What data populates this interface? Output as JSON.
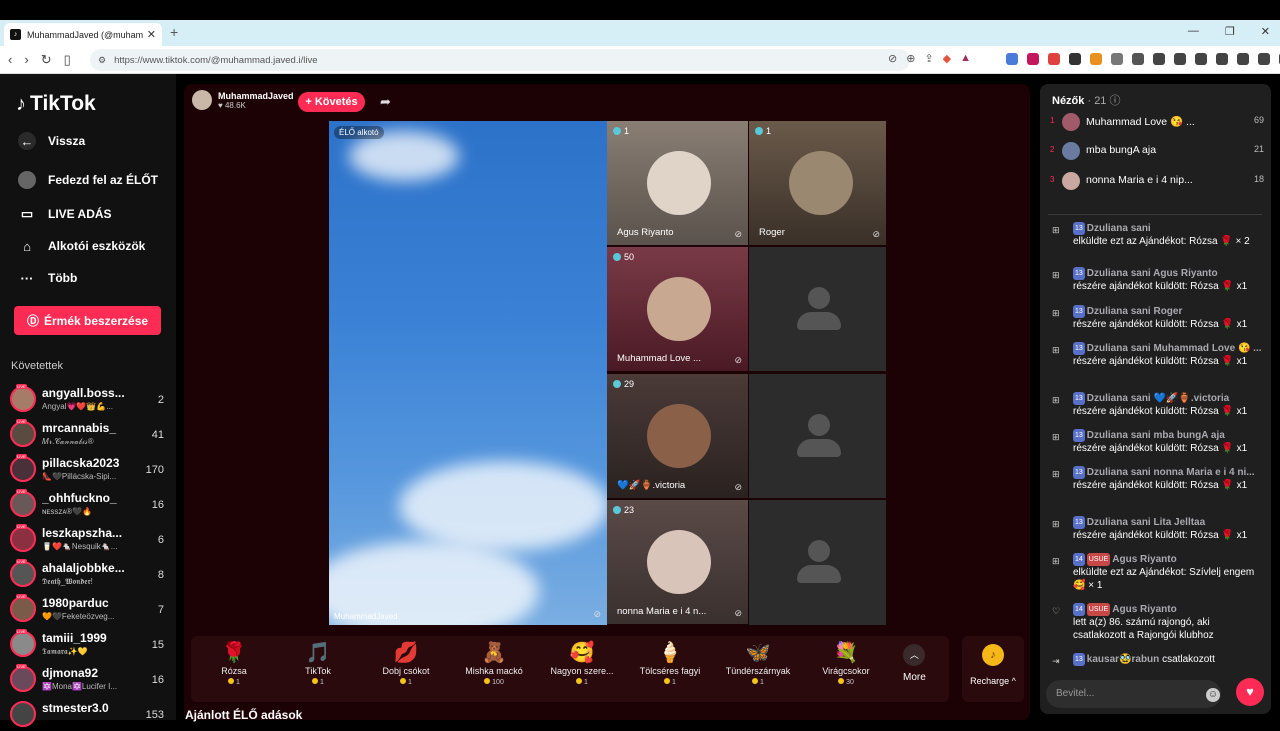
{
  "browser": {
    "tab_title": "MuhammadJaved (@muhamma",
    "url": "https://www.tiktok.com/@muhammad.javed.i/live"
  },
  "sidebar": {
    "logo": "TikTok",
    "nav": [
      {
        "label": "Vissza",
        "icon": "back-arrow-icon"
      },
      {
        "label": "Fedezd fel az ÉLŐT",
        "icon": "explore-live-icon"
      },
      {
        "label": "LIVE ADÁS",
        "icon": "video-icon"
      },
      {
        "label": "Alkotói eszközök",
        "icon": "lightbulb-icon"
      },
      {
        "label": "Több",
        "icon": "more-dots-icon"
      }
    ],
    "coins_button": "Érmék beszerzése",
    "following_heading": "Követettek",
    "following": [
      {
        "name": "angyall.boss...",
        "sub": "Angyal💗❤️👑💪...",
        "count": "2"
      },
      {
        "name": "mrcannabis_",
        "sub": "𝑀𝓇.𝒞𝒶𝓃𝓃𝒶𝒷𝒾𝓈®",
        "count": "41"
      },
      {
        "name": "pillacska2023",
        "sub": "👠🖤Pillácska-Sipi...",
        "count": "170"
      },
      {
        "name": "_ohhfuckno_",
        "sub": "ɴᴇssᴢᴀ®🖤🔥",
        "count": "16"
      },
      {
        "name": "leszkapszha...",
        "sub": "🥛❤️🐁Nesquik🐁...",
        "count": "6"
      },
      {
        "name": "ahalaljobbke...",
        "sub": "𝕯𝖊𝖆𝖙𝖍_𝖂𝖔𝖓𝖉𝖊𝖗!",
        "count": "8"
      },
      {
        "name": "1980parduc",
        "sub": "🧡🖤Feketeözveg...",
        "count": "7"
      },
      {
        "name": "tamiii_1999",
        "sub": "𝕿𝖆𝖒𝖆𝖗𝖆✨💛",
        "count": "15"
      },
      {
        "name": "djmona92",
        "sub": "🔯Mona🔯Lucifer I...",
        "count": "16"
      },
      {
        "name": "stmester3.0",
        "sub": "",
        "count": "153"
      }
    ]
  },
  "stream": {
    "host_name": "MuhammadJaved",
    "host_likes": "♥ 48.6K",
    "follow_button": "+ Követés",
    "main_badge": "ÉLŐ alkotó",
    "main_label": "MuhammadJaved",
    "cells": [
      {
        "count": "1",
        "name": "Agus Riyanto"
      },
      {
        "count": "1",
        "name": "Roger"
      },
      {
        "count": "50",
        "name": "Muhammad Love ..."
      },
      {
        "count": "29",
        "name": "💙🚀🏺.victoria"
      },
      {
        "count": "23",
        "name": "nonna Maria e i 4 n..."
      }
    ],
    "gifts": [
      {
        "name": "Rózsa",
        "price": "1",
        "icon": "🌹"
      },
      {
        "name": "TikTok",
        "price": "1",
        "icon": "🎵"
      },
      {
        "name": "Dobj csókot",
        "price": "1",
        "icon": "💋"
      },
      {
        "name": "Mishka mackó",
        "price": "100",
        "icon": "🧸"
      },
      {
        "name": "Nagyon szere...",
        "price": "1",
        "icon": "🥰"
      },
      {
        "name": "Tölcséres fagyi",
        "price": "1",
        "icon": "🍦"
      },
      {
        "name": "Tündérszárnyak",
        "price": "1",
        "icon": "🦋"
      },
      {
        "name": "Virágcsokor",
        "price": "30",
        "icon": "💐"
      }
    ],
    "more_label": "More",
    "recharge_label": "Recharge ^"
  },
  "recommended_heading": "Ajánlott ÉLŐ adások",
  "chat": {
    "viewers_label": "Nézők",
    "viewers_count": "· 21",
    "top_viewers": [
      {
        "rank": "1",
        "name": "Muhammad Love 😘 ...",
        "count": "69"
      },
      {
        "rank": "2",
        "name": "mba bungA aja",
        "count": "21"
      },
      {
        "rank": "3",
        "name": "nonna Maria e i 4 nip...",
        "count": "18"
      }
    ],
    "messages": [
      {
        "level": "13",
        "user": "Dzuliana sani",
        "text": "elküldte ezt az Ajándékot: Rózsa 🌹 × 2",
        "icon": "gift-icon"
      },
      {
        "level": "13",
        "user": "Dzuliana sani Agus Riyanto",
        "text": "részére ajándékot küldött: Rózsa 🌹 x1",
        "icon": "gift-icon"
      },
      {
        "level": "13",
        "user": "Dzuliana sani Roger",
        "text": "részére ajándékot küldött: Rózsa 🌹 x1",
        "icon": "gift-icon"
      },
      {
        "level": "13",
        "user": "Dzuliana sani Muhammad Love 😘 ...",
        "text": "részére ajándékot küldött: Rózsa 🌹 x1",
        "icon": "gift-icon"
      },
      {
        "level": "13",
        "user": "Dzuliana sani 💙🚀🏺.victoria",
        "text": "részére ajándékot küldött: Rózsa 🌹 x1",
        "icon": "gift-icon"
      },
      {
        "level": "13",
        "user": "Dzuliana sani mba bungA aja",
        "text": "részére ajándékot küldött: Rózsa 🌹 x1",
        "icon": "gift-icon"
      },
      {
        "level": "13",
        "user": "Dzuliana sani nonna Maria e i 4 ni...",
        "text": "részére ajándékot küldött: Rózsa 🌹 x1",
        "icon": "gift-icon"
      },
      {
        "level": "13",
        "user": "Dzuliana sani Lita Jelltaa",
        "text": "részére ajándékot küldött: Rózsa 🌹 x1",
        "icon": "gift-icon"
      },
      {
        "level": "14",
        "fan": "USUE",
        "user": "Agus Riyanto",
        "text": "elküldte ezt az Ajándékot: Szívlelj engem 🥰 × 1",
        "icon": "gift-icon"
      },
      {
        "level": "14",
        "fan": "USUE",
        "user": "Agus Riyanto",
        "text": "lett a(z) 86. számú rajongó, aki csatlakozott a Rajongói klubhoz",
        "icon": "heart-icon"
      },
      {
        "level": "13",
        "user": "kausar🥸rabun",
        "text": "csatlakozott",
        "icon": "join-icon"
      }
    ],
    "input_placeholder": "Bevitel..."
  }
}
